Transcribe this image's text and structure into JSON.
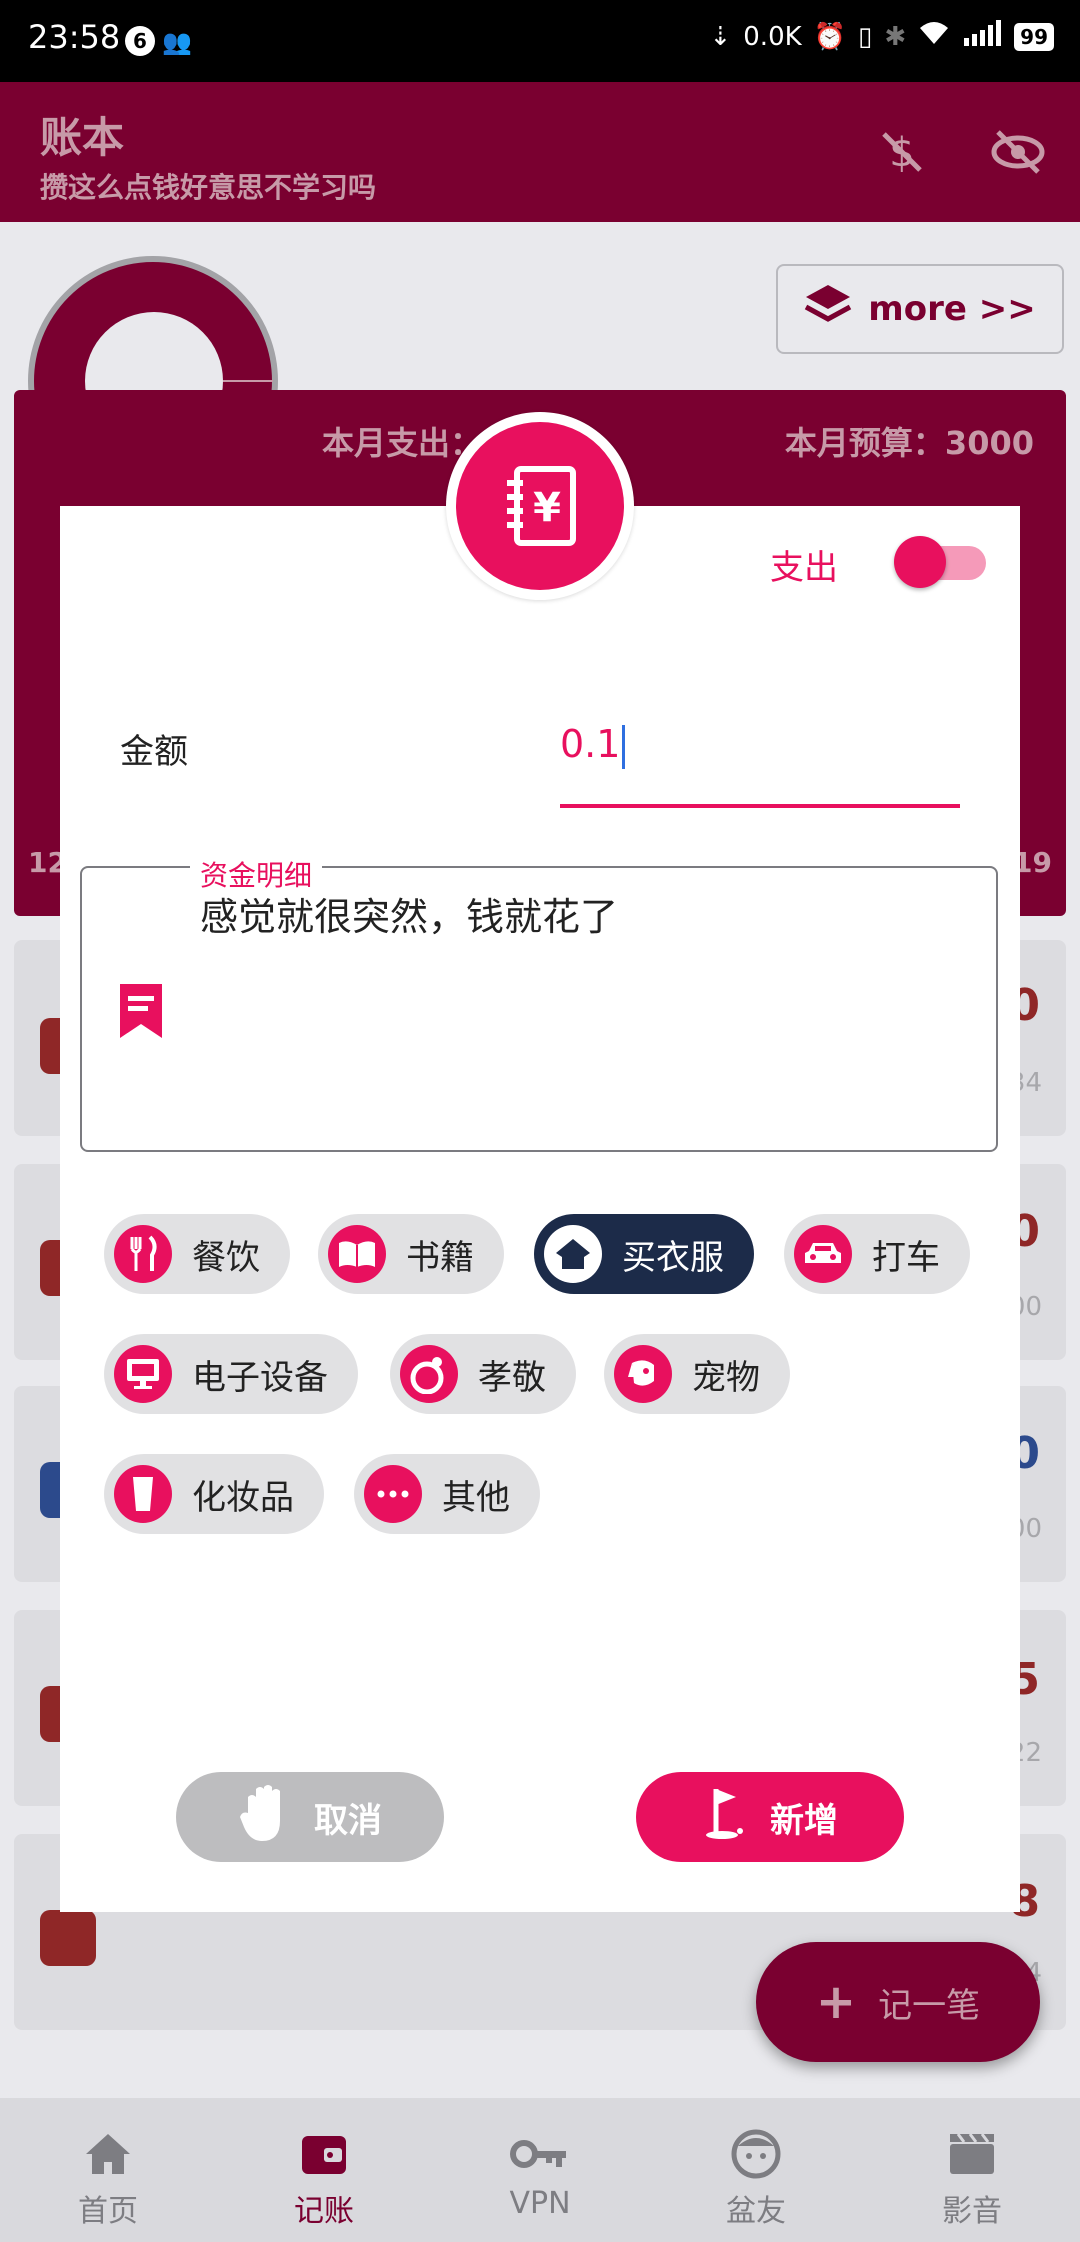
{
  "status_bar": {
    "time": "23:58",
    "notif_badge": "6",
    "net_speed": "0.0K",
    "battery": "99"
  },
  "app_bar": {
    "title": "账本",
    "subtitle": "攒这么点钱好意思不学习吗"
  },
  "summary": {
    "more_label": "more >>",
    "month_spend": "本月支出：",
    "month_budget": "本月预算：3000",
    "left_edge_text": "12",
    "right_edge_text": "19"
  },
  "background_list": [
    {
      "amount": "0",
      "sub": "34"
    },
    {
      "amount": "0",
      "sub": "00"
    },
    {
      "amount": "0",
      "sub": "00"
    },
    {
      "amount": "5",
      "sub": "22"
    },
    {
      "amount": "8",
      "sub": "4"
    }
  ],
  "fab": {
    "label": "记一笔"
  },
  "bottom_nav": [
    {
      "label": "首页",
      "icon": "home-icon"
    },
    {
      "label": "记账",
      "icon": "wallet-icon"
    },
    {
      "label": "VPN",
      "icon": "key-icon"
    },
    {
      "label": "盆友",
      "icon": "face-icon"
    },
    {
      "label": "影音",
      "icon": "clapperboard-icon"
    }
  ],
  "dialog": {
    "type_label": "支出",
    "type_toggle_on": true,
    "amount_label": "金额",
    "amount_value": "0.1",
    "detail_legend": "资金明细",
    "detail_text": "感觉就很突然，钱就花了",
    "categories": [
      {
        "label": "餐饮",
        "icon": "fork-knife-icon",
        "selected": false
      },
      {
        "label": "书籍",
        "icon": "book-icon",
        "selected": false
      },
      {
        "label": "买衣服",
        "icon": "shirt-icon",
        "selected": true
      },
      {
        "label": "打车",
        "icon": "car-icon",
        "selected": false
      },
      {
        "label": "电子设备",
        "icon": "monitor-icon",
        "selected": false
      },
      {
        "label": "孝敬",
        "icon": "gift-icon",
        "selected": false
      },
      {
        "label": "宠物",
        "icon": "dog-icon",
        "selected": false
      },
      {
        "label": "化妆品",
        "icon": "cosmetic-icon",
        "selected": false
      },
      {
        "label": "其他",
        "icon": "more-dots-icon",
        "selected": false
      }
    ],
    "cancel_label": "取消",
    "add_label": "新增"
  },
  "colors": {
    "primary": "#e8105e",
    "dark_primary": "#7a0030",
    "selected_chip": "#1c2b49"
  }
}
